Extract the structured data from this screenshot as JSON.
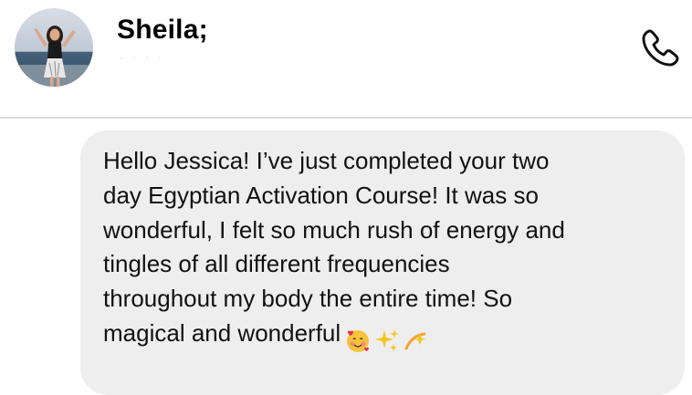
{
  "contact": {
    "name": "Sheila;",
    "status": "· · · ·"
  },
  "header": {
    "call_icon": "phone-icon",
    "avatar_icon": "avatar"
  },
  "message": {
    "lines": [
      "Hello Jessica! I’ve just completed your two",
      "day Egyptian Activation Course! It was so",
      "wonderful, I felt so much rush of energy and",
      "tingles of all different frequencies",
      "throughout my body the entire time! So",
      "magical and wonderful"
    ],
    "emojis": [
      "smiling-face-with-hearts-emoji",
      "sparkles-emoji",
      "dizzy-emoji"
    ]
  },
  "colors": {
    "bubble": "#eeeeee",
    "divider": "#d9d9d9",
    "text": "#111111"
  }
}
